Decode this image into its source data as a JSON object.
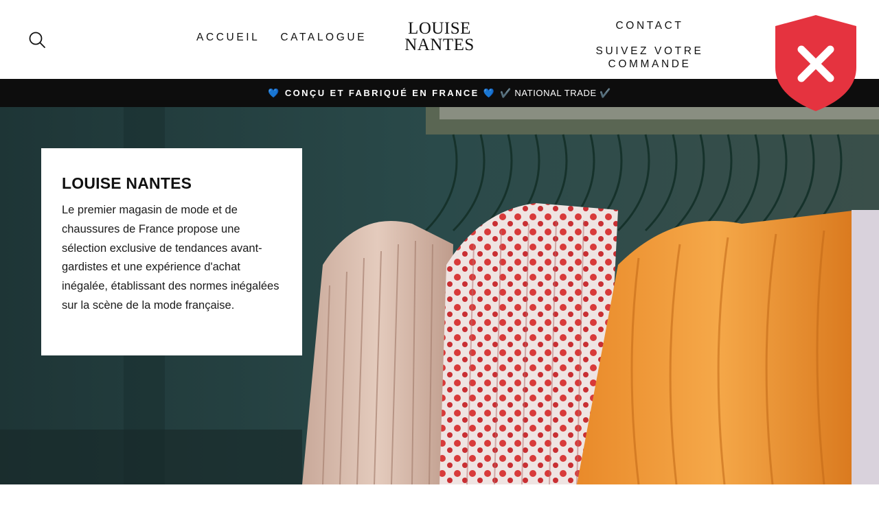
{
  "header": {
    "nav_left": [
      "ACCUEIL",
      "CATALOGUE"
    ],
    "logo_lines": [
      "LOUISE",
      "NANTES"
    ],
    "nav_right": [
      "CONTACT",
      "SUIVEZ VOTRE COMMANDE"
    ]
  },
  "announcement": {
    "bold_text": "💙 CONÇU ET FABRIQUÉ EN FRANCE 💙",
    "thin_text": "✔️ NATIONAL TRADE ✔️"
  },
  "hero": {
    "title": "LOUISE NANTES",
    "description": "Le premier magasin de mode et de chaussures de France propose une sélection exclusive de tendances avant-gardistes et une expérience d'achat inégalée, établissant des normes inégalées sur la scène de la mode française."
  },
  "colors": {
    "announcement_bg": "#0d0d0d",
    "shield_red": "#e5333f",
    "hero_wall": "#1f3a3a"
  },
  "icons": [
    "search-icon",
    "shield-close-icon"
  ]
}
